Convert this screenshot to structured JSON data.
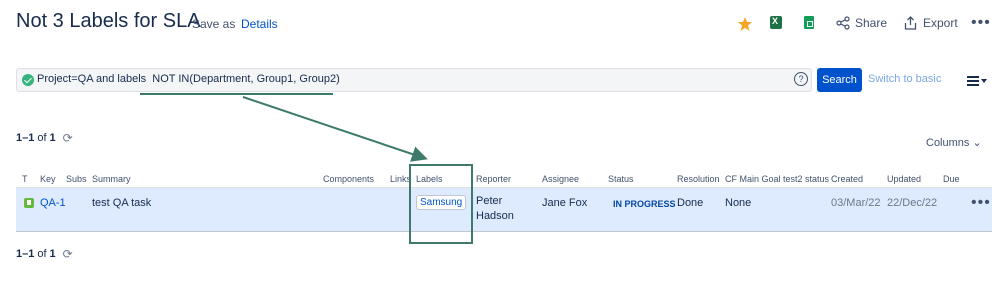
{
  "header": {
    "title": "Not 3 Labels for SLA",
    "save_as": "Save as",
    "details": "Details",
    "share": "Share",
    "export": "Export",
    "more": "•••"
  },
  "query": {
    "text": "Project=QA and labels  NOT IN(Department, Group1, Group2)",
    "help": "?",
    "search_label": "Search",
    "switch_label": "Switch to basic"
  },
  "pager_top": {
    "range": "1–1",
    "of": "of",
    "total": "1"
  },
  "pager_bottom": {
    "range": "1–1",
    "of": "of",
    "total": "1"
  },
  "columns_label": "Columns",
  "table": {
    "headers": {
      "t": "T",
      "key": "Key",
      "subs": "Subs",
      "summary": "Summary",
      "components": "Components",
      "links": "Links",
      "labels": "Labels",
      "reporter": "Reporter",
      "assignee": "Assignee",
      "status": "Status",
      "resolution": "Resolution",
      "cf": "CF Main Goal test2 status",
      "created": "Created",
      "updated": "Updated",
      "due": "Due"
    },
    "rows": [
      {
        "key": "QA-1",
        "summary": "test QA task",
        "label": "Samsung",
        "reporter_first": "Peter",
        "reporter_last": "Hadson",
        "assignee": "Jane Fox",
        "status": "IN PROGRESS",
        "resolution": "Done",
        "cf": "None",
        "created": "03/Mar/22",
        "updated": "22/Dec/22",
        "more": "•••"
      }
    ]
  },
  "colors": {
    "primary": "#0052cc",
    "annotation": "#3d7a6c",
    "row_highlight": "#deebff",
    "star": "#f5a623"
  }
}
